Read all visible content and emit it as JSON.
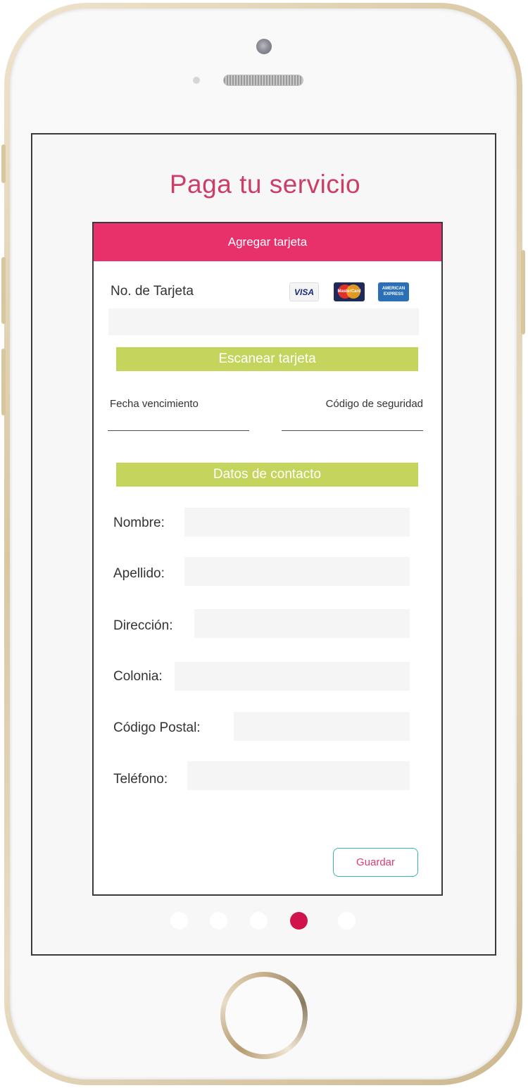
{
  "page": {
    "title": "Paga tu servicio"
  },
  "card": {
    "header": "Agregar tarjeta",
    "card_number_label": "No. de Tarjeta",
    "card_number_value": "",
    "logos": {
      "visa": "VISA",
      "mastercard": "MasterCard",
      "amex": "AMERICAN EXPRESS"
    },
    "scan_button": "Escanear tarjeta",
    "expiry_label": "Fecha vencimiento",
    "security_label": "Código de seguridad"
  },
  "contact": {
    "section_button": "Datos de contacto",
    "fields": {
      "name": "Nombre:",
      "last_name": "Apellido:",
      "address": "Dirección:",
      "neighborhood": "Colonia:",
      "postal_code": "Código Postal:",
      "phone": "Teléfono:"
    }
  },
  "actions": {
    "save": "Guardar"
  },
  "pagination": {
    "total": 5,
    "active_index": 3
  },
  "colors": {
    "accent": "#e8306b",
    "title": "#cc3d68",
    "green": "#c4d45c",
    "save_border": "#39b5ae",
    "active_dot": "#d1134c"
  }
}
